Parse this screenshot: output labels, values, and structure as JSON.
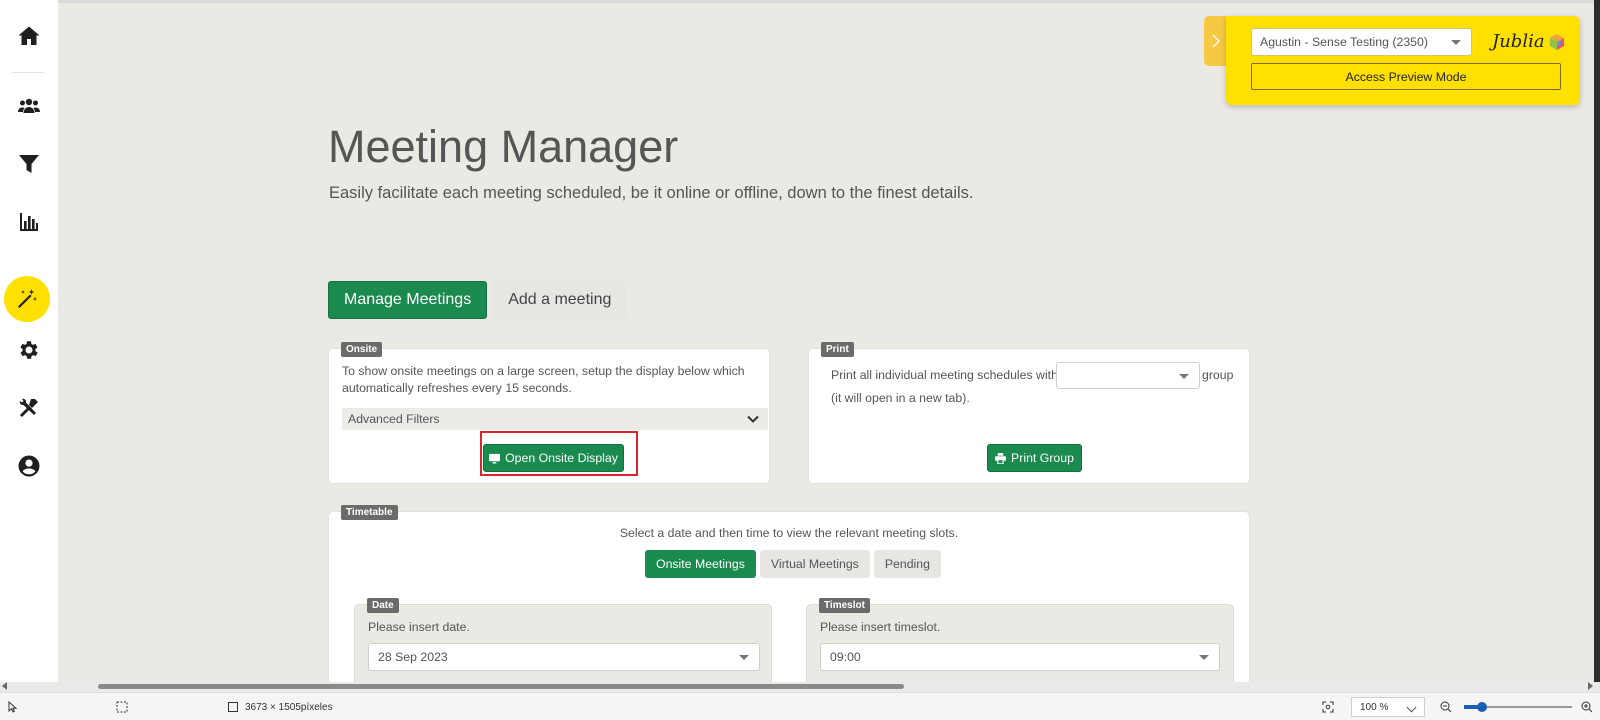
{
  "page": {
    "title": "Meeting Manager",
    "subtitle": "Easily facilitate each meeting scheduled, be it online or offline, down to the finest details."
  },
  "tabs": [
    {
      "label": "Manage Meetings",
      "active": true
    },
    {
      "label": "Add a meeting",
      "active": false
    }
  ],
  "onsite": {
    "badge": "Onsite",
    "text": "To show onsite meetings on a large screen, setup the display below which automatically refreshes every 15 seconds.",
    "advanced_filters": "Advanced Filters",
    "button_label": "Open Onsite Display"
  },
  "print": {
    "badge": "Print",
    "text_before": "Print all individual meeting schedules within",
    "text_after": "group",
    "note": "(it will open in a new tab).",
    "group_value": "",
    "button_label": "Print Group"
  },
  "timetable": {
    "badge": "Timetable",
    "instruction": "Select a date and then time to view the relevant meeting slots.",
    "tabs": [
      {
        "label": "Onsite Meetings",
        "active": true
      },
      {
        "label": "Virtual Meetings",
        "active": false
      },
      {
        "label": "Pending",
        "active": false
      }
    ],
    "date": {
      "badge": "Date",
      "label": "Please insert date.",
      "value": "28 Sep 2023"
    },
    "timeslot": {
      "badge": "Timeslot",
      "label": "Please insert timeslot.",
      "value": "09:00"
    }
  },
  "preview": {
    "account": "Agustin - Sense Testing (2350)",
    "brand": "Jublia",
    "button_label": "Access Preview Mode"
  },
  "statusbar": {
    "dimensions": "3673 × 1505píxeles",
    "zoom": "100 %"
  },
  "colors": {
    "accent_green": "#1a8a4f",
    "accent_yellow": "#ffe000",
    "highlight_red": "#d9262b"
  }
}
